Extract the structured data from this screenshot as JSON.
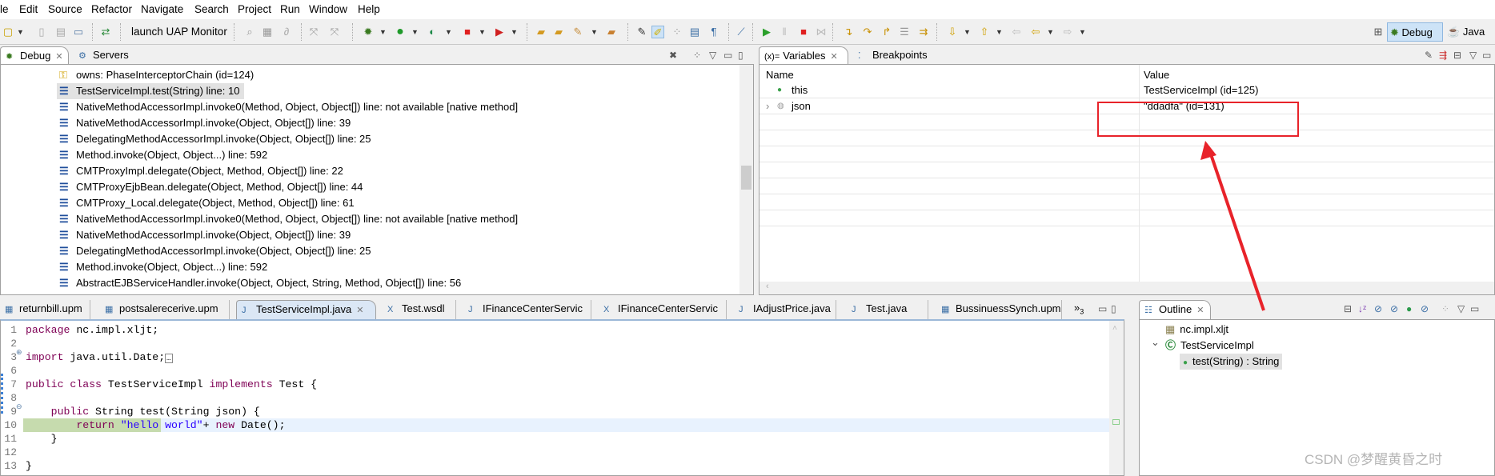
{
  "menubar": {
    "items": [
      "le",
      "Edit",
      "Source",
      "Refactor",
      "Navigate",
      "Search",
      "Project",
      "Run",
      "Window",
      "Help"
    ]
  },
  "toolbar": {
    "launch_label": "launch UAP Monitor"
  },
  "perspectives": {
    "debug": "Debug",
    "java": "Java"
  },
  "debug_view": {
    "tabs": [
      {
        "label": "Debug",
        "active": true
      },
      {
        "label": "Servers",
        "active": false
      }
    ],
    "frames": [
      {
        "label": "owns: PhaseInterceptorChain  (id=124)",
        "icon": "key-icon"
      },
      {
        "label": "TestServiceImpl.test(String) line: 10",
        "icon": "stack-frame-icon",
        "selected": true
      },
      {
        "label": "NativeMethodAccessorImpl.invoke0(Method, Object, Object[]) line: not available [native method]",
        "icon": "stack-frame-icon"
      },
      {
        "label": "NativeMethodAccessorImpl.invoke(Object, Object[]) line: 39",
        "icon": "stack-frame-icon"
      },
      {
        "label": "DelegatingMethodAccessorImpl.invoke(Object, Object[]) line: 25",
        "icon": "stack-frame-icon"
      },
      {
        "label": "Method.invoke(Object, Object...) line: 592",
        "icon": "stack-frame-icon"
      },
      {
        "label": "CMTProxyImpl.delegate(Object, Method, Object[]) line: 22",
        "icon": "stack-frame-icon"
      },
      {
        "label": "CMTProxyEjbBean.delegate(Object, Method, Object[]) line: 44",
        "icon": "stack-frame-icon"
      },
      {
        "label": "CMTProxy_Local.delegate(Object, Method, Object[]) line: 61",
        "icon": "stack-frame-icon"
      },
      {
        "label": "NativeMethodAccessorImpl.invoke0(Method, Object, Object[]) line: not available [native method]",
        "icon": "stack-frame-icon"
      },
      {
        "label": "NativeMethodAccessorImpl.invoke(Object, Object[]) line: 39",
        "icon": "stack-frame-icon"
      },
      {
        "label": "DelegatingMethodAccessorImpl.invoke(Object, Object[]) line: 25",
        "icon": "stack-frame-icon"
      },
      {
        "label": "Method.invoke(Object, Object...) line: 592",
        "icon": "stack-frame-icon"
      },
      {
        "label": "AbstractEJBServiceHandler.invoke(Object, Object, String, Method, Object[]) line: 56",
        "icon": "stack-frame-icon"
      }
    ]
  },
  "variables_view": {
    "tabs": [
      {
        "label": "Variables",
        "prefix": "(x)=",
        "active": true
      },
      {
        "label": "Breakpoints",
        "active": false
      }
    ],
    "columns": [
      "Name",
      "Value"
    ],
    "rows": [
      {
        "name": "this",
        "value": "TestServiceImpl  (id=125)",
        "expandable": false
      },
      {
        "name": "json",
        "value": "\"ddadfa\" (id=131)",
        "expandable": true
      }
    ],
    "highlight_color": "#e8232a"
  },
  "editor": {
    "tabs": [
      {
        "label": "returnbill.upm",
        "icon": "upm-file-icon"
      },
      {
        "label": "postsalerecerive.upm",
        "icon": "upm-file-icon"
      },
      {
        "label": "TestServiceImpl.java",
        "icon": "java-file-icon",
        "active": true
      },
      {
        "label": "Test.wsdl",
        "icon": "wsdl-file-icon"
      },
      {
        "label": "IFinanceCenterServic",
        "icon": "java-file-icon"
      },
      {
        "label": "IFinanceCenterServic",
        "icon": "wsdl-file-icon"
      },
      {
        "label": "IAdjustPrice.java",
        "icon": "java-file-icon"
      },
      {
        "label": "Test.java",
        "icon": "java-file-icon"
      },
      {
        "label": "BussinuessSynch.upm",
        "icon": "upm-file-icon"
      }
    ],
    "overflow_label": "»",
    "overflow_count": "3",
    "current_line": 10,
    "lines": [
      {
        "num": "1",
        "tokens": [
          {
            "t": "package",
            "k": "kw"
          },
          {
            "t": " nc.impl.xljt;"
          }
        ]
      },
      {
        "num": "2",
        "tokens": []
      },
      {
        "num": "3",
        "fold": "plus",
        "tokens": [
          {
            "t": "import",
            "k": "kw"
          },
          {
            "t": " java.util.Date;"
          },
          {
            "t": "…",
            "k": "box"
          }
        ]
      },
      {
        "num": "6",
        "tokens": []
      },
      {
        "num": "7",
        "tokens": [
          {
            "t": "public",
            "k": "kw"
          },
          {
            "t": " "
          },
          {
            "t": "class",
            "k": "kw"
          },
          {
            "t": " TestServiceImpl "
          },
          {
            "t": "implements",
            "k": "kw"
          },
          {
            "t": " Test {"
          }
        ]
      },
      {
        "num": "8",
        "tokens": []
      },
      {
        "num": "9",
        "fold": "minus",
        "tokens": [
          {
            "t": "    "
          },
          {
            "t": "public",
            "k": "kw"
          },
          {
            "t": " String test(String json) {"
          }
        ]
      },
      {
        "num": "10",
        "tokens": [
          {
            "t": "        "
          },
          {
            "t": "return",
            "k": "kw"
          },
          {
            "t": " "
          },
          {
            "t": "\"hello world\"",
            "k": "str"
          },
          {
            "t": "+ "
          },
          {
            "t": "new",
            "k": "kw"
          },
          {
            "t": " Date();"
          }
        ]
      },
      {
        "num": "11",
        "tokens": [
          {
            "t": "    }"
          }
        ]
      },
      {
        "num": "12",
        "tokens": []
      },
      {
        "num": "13",
        "tokens": [
          {
            "t": "}"
          }
        ]
      }
    ]
  },
  "outline": {
    "tab": "Outline",
    "items": [
      {
        "label": "nc.impl.xljt",
        "icon": "package-icon",
        "level": 0
      },
      {
        "label": "TestServiceImpl",
        "icon": "class-icon",
        "level": 0,
        "expanded": true
      },
      {
        "label": "test(String) : String",
        "icon": "public-method-icon",
        "level": 1,
        "selected": true
      }
    ]
  },
  "watermark": "CSDN @梦醒黄昏之时"
}
